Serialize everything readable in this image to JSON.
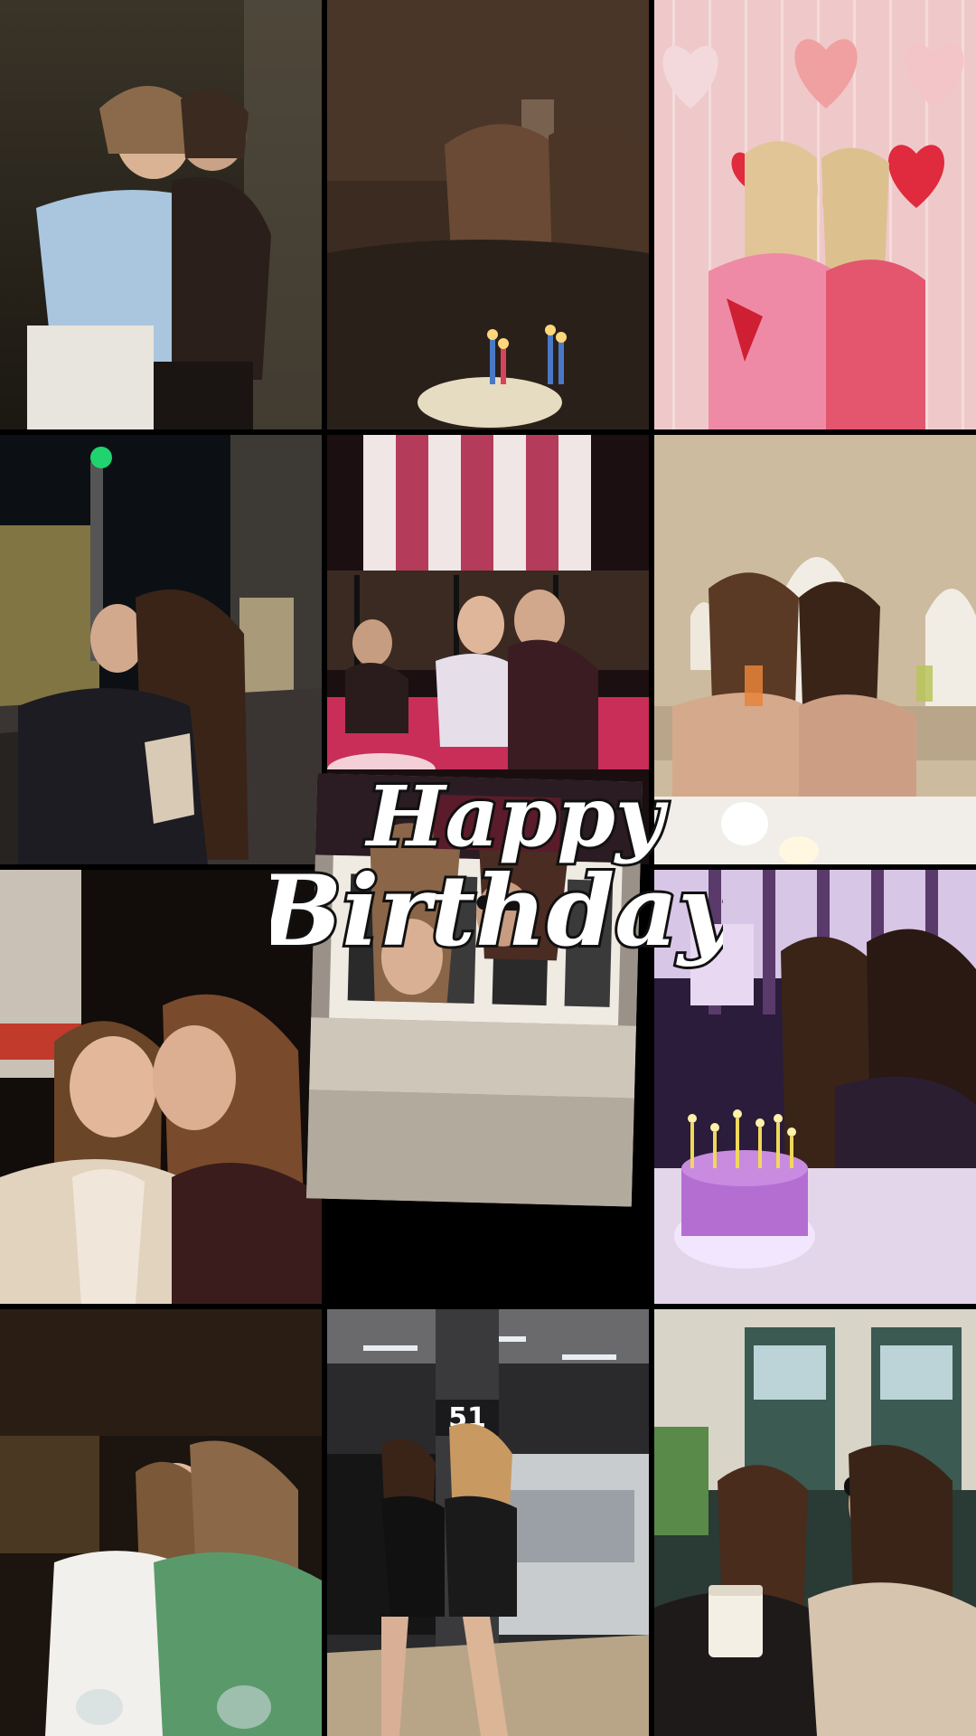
{
  "title": {
    "line1": "Happy",
    "line2": "Birthday"
  },
  "photos": [
    {
      "name": "photo-hug-brick-wall",
      "scene": "night-brick"
    },
    {
      "name": "photo-blowing-candles",
      "scene": "dark-candles"
    },
    {
      "name": "photo-pink-hearts",
      "scene": "pink-hearts"
    },
    {
      "name": "photo-street-night",
      "scene": "street-night"
    },
    {
      "name": "photo-restaurant-awning",
      "scene": "restaurant"
    },
    {
      "name": "photo-cream-dining",
      "scene": "cream-dining"
    },
    {
      "name": "photo-cheek-kiss",
      "scene": "cheek-kiss"
    },
    {
      "name": "photo-upside-down-selfie",
      "scene": "upside-down"
    },
    {
      "name": "photo-purple-cake",
      "scene": "purple-cake"
    },
    {
      "name": "photo-laughing-table",
      "scene": "laughing"
    },
    {
      "name": "photo-subway-platform",
      "scene": "subway"
    },
    {
      "name": "photo-coffee-sunglasses",
      "scene": "coffee"
    }
  ],
  "signs": {
    "subway_number": "51"
  },
  "colors": {
    "background": "#000000",
    "title_fill": "#ffffff",
    "title_outline": "#111111"
  }
}
